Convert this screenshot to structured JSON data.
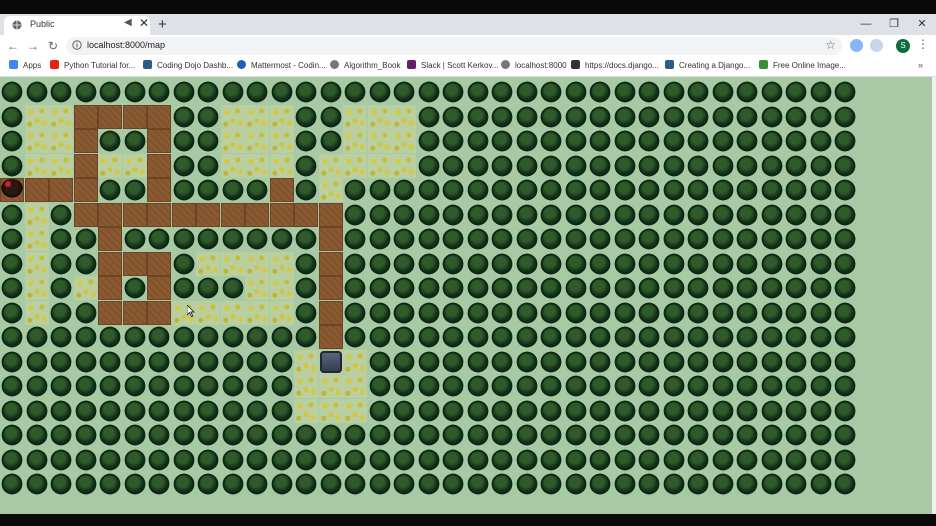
{
  "browser": {
    "tab": {
      "title": "Public",
      "audio_icon": "speaker-muted-icon",
      "close": "✕"
    },
    "new_tab": "+",
    "window_controls": [
      "—",
      "❐",
      "✕"
    ],
    "nav": {
      "back": "←",
      "forward": "→",
      "reload": "↻"
    },
    "url": "localhost:8000/map",
    "star": "☆",
    "avatar_letter": "S",
    "menu": "⋮"
  },
  "bookmarks": {
    "items": [
      {
        "label": "Apps",
        "icon_color": "#4285f4"
      },
      {
        "label": "Python Tutorial for...",
        "icon_color": "#e62117"
      },
      {
        "label": "Coding Dojo Dashb...",
        "icon_color": "#2c5a8c"
      },
      {
        "label": "Mattermost - Codin...",
        "icon_color": "#1f5cc0"
      },
      {
        "label": "Algorithm_Book",
        "icon_color": "#777777"
      },
      {
        "label": "Slack | Scott Kerkov...",
        "icon_color": "#611f69"
      },
      {
        "label": "localhost:8000",
        "icon_color": "#777777"
      },
      {
        "label": "https://docs.django...",
        "icon_color": "#333333"
      },
      {
        "label": "Creating a Django...",
        "icon_color": "#2c5a8c"
      },
      {
        "label": "Free Online Image...",
        "icon_color": "#3b8f3b"
      }
    ],
    "more": "»"
  },
  "game": {
    "colors": {
      "background": "#a7c9a3",
      "tree": "#12301a",
      "path": "#8b5a32",
      "grass": "#b9cfa0"
    },
    "map": [
      "TTTTTTTTTTTTTTTTTTTTTTTTTTTTTTTTTTT",
      "TGGPPPPTTGGGTTGGGTTTTTTTTTTTTTTTTTT",
      "TGGPTTPTTGGGTTGGGTTTTTTTTTTTTTTTTTT",
      "TGGPGGPTTGGGTGGGGTTTTTTTTTTTTTTTTTT",
      "XPPPTTPTTTTPTGTTTTTTTTTTTTTTTTTTTTT",
      "TGTPPPPPPPPPPPTTTTTTTTTTTTTTTTTTTTT",
      "TGTTPTTTTTTTTPTTTTTTTTTTTTTTTTTTTTT",
      "TGTTPPPTGGGGTPTTTTTTTTTTTTTTTTTTTTT",
      "TGTGPTPTTTGGTPTTTTTTTTTTTTTTTTTTTTT",
      "TGTTPPPGGGGGTPTTTTTTTTTTTTTTTTTTTTT",
      "TTTTTTTTTTTTTPTTTTTTTTTTTTTTTTTTTTT",
      "TTTTTTTTTTTTGMGTTTTTTTTTTTTTTTTTTTT",
      "TTTTTTTTTTTTGGGTTTTTTTTTTTTTTTTTTTT",
      "TTTTTTTTTTTTGGGTTTTTTTTTTTTTTTTTTTT",
      "TTTTTTTTTTTTTTTTTTTTTTTTTTTTTTTTTTT",
      "TTTTTTTTTTTTTTTTTTTTTTTTTTTTTTTTTTT",
      "TTTTTTTTTTTTTTTTTTTTTTTTTTTTTTTTTTT"
    ],
    "legend": {
      "T": "tree",
      "G": "grass",
      "P": "path",
      "X": "player",
      "M": "monster"
    }
  }
}
